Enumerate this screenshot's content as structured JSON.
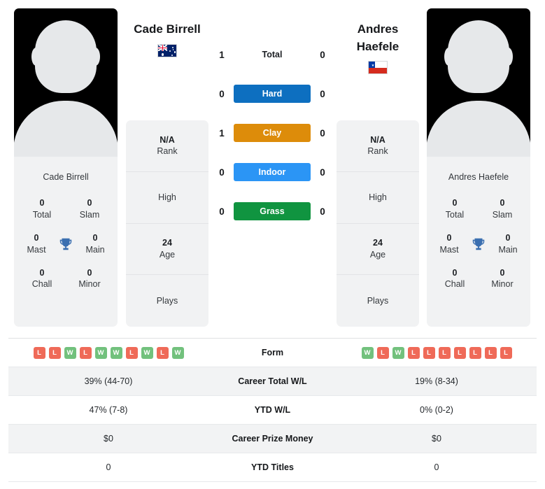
{
  "players": {
    "left": {
      "name": "Cade Birrell",
      "photo_caption": "Cade Birrell",
      "flag": "australia-flag",
      "rank_value": "N/A",
      "rank_label": "Rank",
      "high_value": "",
      "high_label": "High",
      "age_value": "24",
      "age_label": "Age",
      "plays_value": "",
      "plays_label": "Plays",
      "titles": [
        {
          "value": "0",
          "label": "Total"
        },
        {
          "value": "0",
          "label": "Slam"
        },
        {
          "value": "0",
          "label": "Mast"
        },
        {
          "value": "0",
          "label": "Main"
        },
        {
          "value": "0",
          "label": "Chall"
        },
        {
          "value": "0",
          "label": "Minor"
        }
      ]
    },
    "right": {
      "name": "Andres Haefele",
      "photo_caption": "Andres Haefele",
      "flag": "chile-flag",
      "rank_value": "N/A",
      "rank_label": "Rank",
      "high_value": "",
      "high_label": "High",
      "age_value": "24",
      "age_label": "Age",
      "plays_value": "",
      "plays_label": "Plays",
      "titles": [
        {
          "value": "0",
          "label": "Total"
        },
        {
          "value": "0",
          "label": "Slam"
        },
        {
          "value": "0",
          "label": "Mast"
        },
        {
          "value": "0",
          "label": "Main"
        },
        {
          "value": "0",
          "label": "Chall"
        },
        {
          "value": "0",
          "label": "Minor"
        }
      ]
    }
  },
  "head_to_head": {
    "rows": [
      {
        "left": "1",
        "label": "Total",
        "right": "0",
        "color": "",
        "is_badge": false
      },
      {
        "left": "0",
        "label": "Hard",
        "right": "0",
        "color": "#0d6fc0",
        "is_badge": true
      },
      {
        "left": "1",
        "label": "Clay",
        "right": "0",
        "color": "#dd8c0a",
        "is_badge": true
      },
      {
        "left": "0",
        "label": "Indoor",
        "right": "0",
        "color": "#2b95f5",
        "is_badge": true
      },
      {
        "left": "0",
        "label": "Grass",
        "right": "0",
        "color": "#109440",
        "is_badge": true
      }
    ]
  },
  "stats_table": {
    "rows": [
      {
        "label": "Form",
        "type": "form",
        "left_form": [
          "L",
          "L",
          "W",
          "L",
          "W",
          "W",
          "L",
          "W",
          "L",
          "W"
        ],
        "right_form": [
          "W",
          "L",
          "W",
          "L",
          "L",
          "L",
          "L",
          "L",
          "L",
          "L"
        ],
        "left": "",
        "right": ""
      },
      {
        "label": "Career Total W/L",
        "type": "text",
        "left": "39% (44-70)",
        "right": "19% (8-34)"
      },
      {
        "label": "YTD W/L",
        "type": "text",
        "left": "47% (7-8)",
        "right": "0% (0-2)"
      },
      {
        "label": "Career Prize Money",
        "type": "text",
        "left": "$0",
        "right": "$0"
      },
      {
        "label": "YTD Titles",
        "type": "text",
        "left": "0",
        "right": "0"
      }
    ]
  },
  "colors": {
    "hard": "#0d6fc0",
    "clay": "#dd8c0a",
    "indoor": "#2b95f5",
    "grass": "#109440",
    "win": "#72c17d",
    "loss": "#ef6a58",
    "trophy": "#3b6fb0",
    "card_bg": "#f1f2f3",
    "row_alt": "#f2f3f4"
  }
}
